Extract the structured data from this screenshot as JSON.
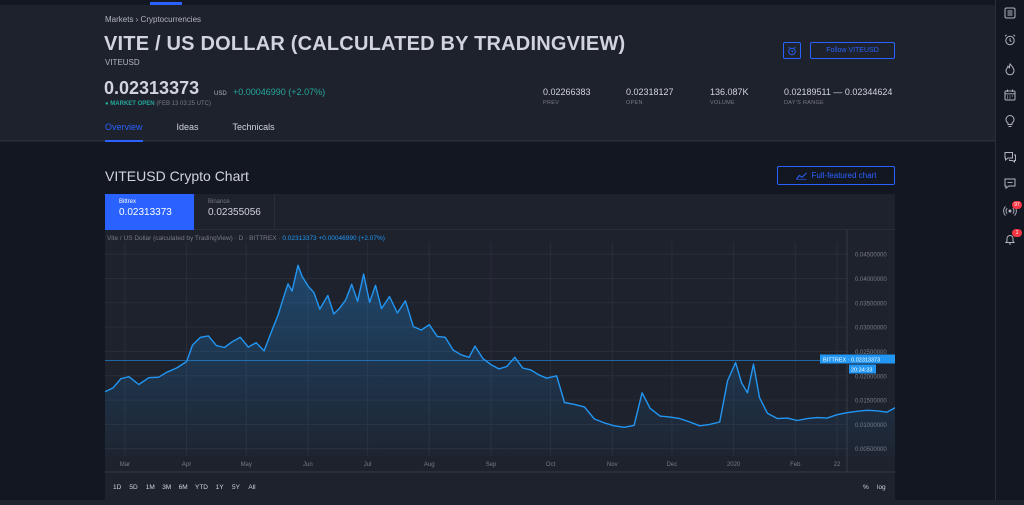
{
  "breadcrumb": "Markets › Cryptocurrencies",
  "header": {
    "title": "VITE / US DOLLAR (CALCULATED BY TRADINGVIEW)",
    "ticker": "VITEUSD",
    "price": "0.02313373",
    "currency": "USD",
    "change": "+0.00046990 (+2.07%)",
    "market_status": "MARKET OPEN",
    "market_time": "(FEB 13 03:25 UTC)",
    "follow_label": "Follow VITEUSD",
    "stats": [
      {
        "value": "0.02266383",
        "label": "PREV"
      },
      {
        "value": "0.02318127",
        "label": "OPEN"
      },
      {
        "value": "136.087K",
        "label": "VOLUME"
      },
      {
        "value": "0.02189511 — 0.02344624",
        "label": "DAY'S RANGE"
      }
    ]
  },
  "tabs": [
    "Overview",
    "Ideas",
    "Technicals"
  ],
  "chart_section": {
    "heading": "VITEUSD Crypto Chart",
    "full_chart_label": "Full-featured chart",
    "exchanges": [
      {
        "name": "Bittrex",
        "price": "0.02313373",
        "selected": true
      },
      {
        "name": "Binance",
        "price": "0.02355056",
        "selected": false
      }
    ],
    "legend_prefix": "Vite / US Dollar (calculated by TradingView) · D · BITTREX ·",
    "legend_values": "0.02313373  +0.00046990 (+2.07%)",
    "price_tag": "BITTREX · 0.02313373",
    "countdown": "20:34:33",
    "ranges": [
      "1D",
      "5D",
      "1M",
      "3M",
      "6M",
      "YTD",
      "1Y",
      "5Y",
      "All"
    ],
    "percent_toggle": "%",
    "log_toggle": "log"
  },
  "colors": {
    "accent": "#2962ff",
    "line": "#2196f3",
    "positive": "#26a69a",
    "badge": "#f23645"
  },
  "sidebar": {
    "icons": [
      "watchlist-icon",
      "alarm-clock-icon",
      "hotlist-icon",
      "calendar-icon",
      "ideas-bulb-icon",
      "chat-icon",
      "messages-icon",
      "streams-icon",
      "notifications-icon"
    ],
    "badges": {
      "streams": "97",
      "notifications": "1"
    }
  },
  "chart_data": {
    "type": "line",
    "title": "",
    "series": [
      {
        "name": "BITTREX",
        "points": [
          [
            "2019-02-19",
            0.0167
          ],
          [
            "2019-02-23",
            0.0175
          ],
          [
            "2019-02-27",
            0.0194
          ],
          [
            "2019-03-03",
            0.0198
          ],
          [
            "2019-03-08",
            0.0182
          ],
          [
            "2019-03-13",
            0.0196
          ],
          [
            "2019-03-18",
            0.0197
          ],
          [
            "2019-03-22",
            0.0207
          ],
          [
            "2019-03-27",
            0.0216
          ],
          [
            "2019-04-01",
            0.0229
          ],
          [
            "2019-04-04",
            0.0263
          ],
          [
            "2019-04-08",
            0.0279
          ],
          [
            "2019-04-12",
            0.0282
          ],
          [
            "2019-04-16",
            0.0262
          ],
          [
            "2019-04-20",
            0.0258
          ],
          [
            "2019-04-24",
            0.027
          ],
          [
            "2019-04-28",
            0.0279
          ],
          [
            "2019-05-02",
            0.0259
          ],
          [
            "2019-05-06",
            0.0268
          ],
          [
            "2019-05-10",
            0.0251
          ],
          [
            "2019-05-14",
            0.0294
          ],
          [
            "2019-05-17",
            0.0325
          ],
          [
            "2019-05-19",
            0.0351
          ],
          [
            "2019-05-22",
            0.0389
          ],
          [
            "2019-05-24",
            0.0374
          ],
          [
            "2019-05-27",
            0.0427
          ],
          [
            "2019-05-29",
            0.0405
          ],
          [
            "2019-06-01",
            0.0385
          ],
          [
            "2019-06-04",
            0.0371
          ],
          [
            "2019-06-07",
            0.0337
          ],
          [
            "2019-06-11",
            0.0365
          ],
          [
            "2019-06-14",
            0.0327
          ],
          [
            "2019-06-17",
            0.0339
          ],
          [
            "2019-06-20",
            0.0356
          ],
          [
            "2019-06-23",
            0.0388
          ],
          [
            "2019-06-26",
            0.0353
          ],
          [
            "2019-06-29",
            0.0409
          ],
          [
            "2019-07-02",
            0.0351
          ],
          [
            "2019-07-05",
            0.0386
          ],
          [
            "2019-07-08",
            0.0338
          ],
          [
            "2019-07-12",
            0.0363
          ],
          [
            "2019-07-16",
            0.0329
          ],
          [
            "2019-07-20",
            0.0354
          ],
          [
            "2019-07-24",
            0.0301
          ],
          [
            "2019-07-28",
            0.0294
          ],
          [
            "2019-08-01",
            0.0305
          ],
          [
            "2019-08-05",
            0.0281
          ],
          [
            "2019-08-09",
            0.0279
          ],
          [
            "2019-08-13",
            0.0253
          ],
          [
            "2019-08-17",
            0.0243
          ],
          [
            "2019-08-21",
            0.0238
          ],
          [
            "2019-08-24",
            0.0261
          ],
          [
            "2019-08-28",
            0.0235
          ],
          [
            "2019-09-01",
            0.0223
          ],
          [
            "2019-09-05",
            0.0214
          ],
          [
            "2019-09-09",
            0.0219
          ],
          [
            "2019-09-13",
            0.0238
          ],
          [
            "2019-09-17",
            0.0216
          ],
          [
            "2019-09-21",
            0.0212
          ],
          [
            "2019-09-25",
            0.0202
          ],
          [
            "2019-09-29",
            0.0195
          ],
          [
            "2019-10-04",
            0.02
          ],
          [
            "2019-10-08",
            0.0145
          ],
          [
            "2019-10-13",
            0.0141
          ],
          [
            "2019-10-18",
            0.0136
          ],
          [
            "2019-10-23",
            0.0111
          ],
          [
            "2019-10-28",
            0.0103
          ],
          [
            "2019-11-02",
            0.0097
          ],
          [
            "2019-11-07",
            0.0094
          ],
          [
            "2019-11-12",
            0.0098
          ],
          [
            "2019-11-16",
            0.0165
          ],
          [
            "2019-11-20",
            0.0133
          ],
          [
            "2019-11-25",
            0.0117
          ],
          [
            "2019-11-30",
            0.0115
          ],
          [
            "2019-12-05",
            0.0112
          ],
          [
            "2019-12-10",
            0.0105
          ],
          [
            "2019-12-15",
            0.0097
          ],
          [
            "2019-12-20",
            0.01
          ],
          [
            "2019-12-25",
            0.0105
          ],
          [
            "2019-12-29",
            0.019
          ],
          [
            "2020-01-02",
            0.0227
          ],
          [
            "2020-01-05",
            0.0185
          ],
          [
            "2020-01-08",
            0.0165
          ],
          [
            "2020-01-11",
            0.0224
          ],
          [
            "2020-01-14",
            0.0155
          ],
          [
            "2020-01-18",
            0.0123
          ],
          [
            "2020-01-23",
            0.0112
          ],
          [
            "2020-01-28",
            0.0113
          ],
          [
            "2020-02-02",
            0.0108
          ],
          [
            "2020-02-07",
            0.0112
          ],
          [
            "2020-02-12",
            0.0114
          ],
          [
            "2020-02-17",
            0.0113
          ],
          [
            "2020-02-22",
            0.012
          ],
          [
            "2020-02-27",
            0.0124
          ],
          [
            "2020-03-03",
            0.0127
          ],
          [
            "2020-03-08",
            0.0129
          ],
          [
            "2020-03-13",
            0.0128
          ],
          [
            "2020-03-18",
            0.0125
          ],
          [
            "2020-03-23",
            0.0136
          ],
          [
            "2020-03-27",
            0.0156
          ],
          [
            "2020-03-29",
            0.0231
          ]
        ]
      }
    ],
    "x_ticks": [
      {
        "label": "Mar",
        "date": "2019-03-01"
      },
      {
        "label": "Apr",
        "date": "2019-04-01"
      },
      {
        "label": "May",
        "date": "2019-05-01"
      },
      {
        "label": "Jun",
        "date": "2019-06-01"
      },
      {
        "label": "Jul",
        "date": "2019-07-01"
      },
      {
        "label": "Aug",
        "date": "2019-08-01"
      },
      {
        "label": "Sep",
        "date": "2019-09-01"
      },
      {
        "label": "Oct",
        "date": "2019-10-01"
      },
      {
        "label": "Nov",
        "date": "2019-11-01"
      },
      {
        "label": "Dec",
        "date": "2019-12-01"
      },
      {
        "label": "2020",
        "date": "2020-01-01"
      },
      {
        "label": "Feb",
        "date": "2020-02-01"
      },
      {
        "label": "22",
        "date": "2020-02-22"
      }
    ],
    "y_ticks": [
      "0.04500000",
      "0.04000000",
      "0.03500000",
      "0.03000000",
      "0.02500000",
      "0.02000000",
      "0.01500000",
      "0.01000000",
      "0.00500000"
    ],
    "y_tick_values": [
      0.045,
      0.04,
      0.035,
      0.03,
      0.025,
      0.02,
      0.015,
      0.01,
      0.005
    ],
    "ylim": [
      0.0035,
      0.0475
    ],
    "xlim": [
      "2019-02-19",
      "2020-02-27"
    ],
    "last_value": 0.02313373,
    "grid": true,
    "area_fill": true
  }
}
